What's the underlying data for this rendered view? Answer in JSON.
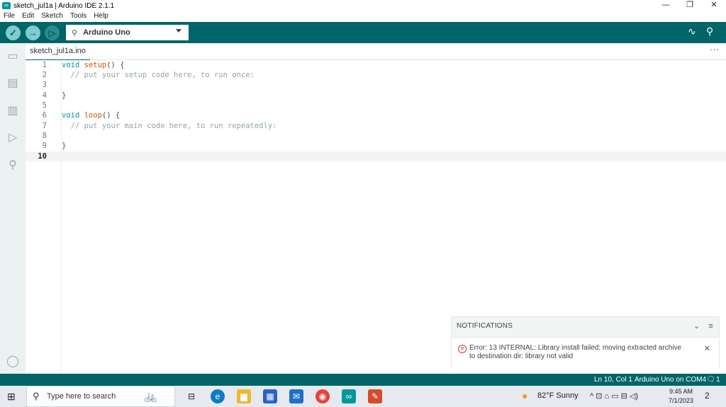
{
  "window": {
    "title": "sketch_jul1a | Arduino IDE 2.1.1",
    "controls": {
      "minimize": "—",
      "maximize": "❐",
      "close": "✕"
    }
  },
  "menu": [
    "File",
    "Edit",
    "Sketch",
    "Tools",
    "Help"
  ],
  "toolbar": {
    "verify_icon": "✓",
    "upload_icon": "→",
    "debug_icon": "▷",
    "board_name": "Arduino Uno",
    "usb_icon": "⚲",
    "serial_plotter_icon": "∿",
    "serial_monitor_icon": "⚲"
  },
  "sidebar": {
    "sketchbook_icon": "▭",
    "boards_icon": "▤",
    "library_icon": "▥",
    "debug_icon": "▷",
    "search_icon": "⚲",
    "profile_icon": "◯"
  },
  "tab": {
    "label": "sketch_jul1a.ino",
    "more": "···"
  },
  "editor": {
    "lines": [
      {
        "n": "1",
        "kw": "void ",
        "fn": "setup",
        "rest": "() {",
        "cm": ""
      },
      {
        "n": "2",
        "kw": "",
        "fn": "",
        "rest": "  ",
        "cm": "// put your setup code here, to run once:"
      },
      {
        "n": "3",
        "kw": "",
        "fn": "",
        "rest": "",
        "cm": ""
      },
      {
        "n": "4",
        "kw": "",
        "fn": "",
        "rest": "}",
        "cm": ""
      },
      {
        "n": "5",
        "kw": "",
        "fn": "",
        "rest": "",
        "cm": ""
      },
      {
        "n": "6",
        "kw": "void ",
        "fn": "loop",
        "rest": "() {",
        "cm": ""
      },
      {
        "n": "7",
        "kw": "",
        "fn": "",
        "rest": "  ",
        "cm": "// put your main code here, to run repeatedly:"
      },
      {
        "n": "8",
        "kw": "",
        "fn": "",
        "rest": "",
        "cm": ""
      },
      {
        "n": "9",
        "kw": "",
        "fn": "",
        "rest": "}",
        "cm": ""
      },
      {
        "n": "10",
        "kw": "",
        "fn": "",
        "rest": "",
        "cm": ""
      }
    ]
  },
  "notifications": {
    "header": "NOTIFICATIONS",
    "collapse_icon": "⌄",
    "clear_icon": "≡",
    "message": "Error: 13 INTERNAL: Library install failed: moving extracted archive to destination dir: library not valid",
    "error_icon": "✕",
    "close_icon": "✕"
  },
  "statusbar": {
    "position": "Ln 10, Col 1",
    "board_port": "Arduino Uno on COM4",
    "notif_count": "1",
    "notif_icon": "🗨"
  },
  "taskbar": {
    "start_icon": "⊞",
    "search_placeholder": "Type here to search",
    "search_icon": "⚲",
    "bike_icon": "🚲",
    "weather": "82°F  Sunny",
    "sun_icon": "●",
    "tray_icons": "^  ⊡  ⌂  ▭  ⊟  ◁)",
    "time": "9:45 AM",
    "date": "7/1/2023",
    "action_center": "2",
    "apps": {
      "taskview": "⊟",
      "edge": "e",
      "explorer": "▆",
      "store": "▦",
      "mail": "✉",
      "chrome": "◉",
      "arduino": "∞",
      "other": "✎"
    }
  }
}
